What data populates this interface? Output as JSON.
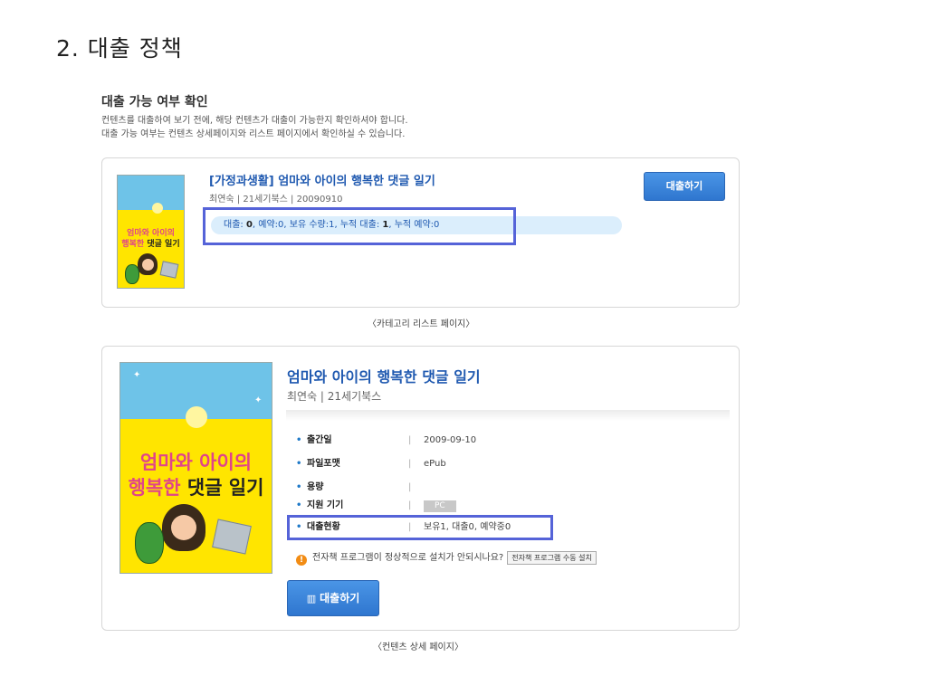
{
  "slide": {
    "title": "2. 대출 정책"
  },
  "section": {
    "title": "대출 가능 여부 확인",
    "desc_line1": "컨텐츠를 대출하여 보기 전에, 해당 컨텐츠가 대출이 가능한지 확인하셔야 합니다.",
    "desc_line2": "대출 가능 여부는 컨텐츠 상세페이지와 리스트 페이지에서 확인하실 수 있습니다."
  },
  "list_card": {
    "category": "[가정과생활]",
    "title": " 엄마와 아이의 행복한 댓글 일기",
    "meta": "최연숙 | 21세기북스 | 20090910",
    "stats_prefix": "대출: ",
    "stats_loan": "0",
    "stats_mid": ", 예약:0, 보유 수량:1, 누적 대출: ",
    "stats_total": "1",
    "stats_suffix": ", 누적 예약:0",
    "borrow_button": "대출하기",
    "caption": "〈카테고리 리스트 페이지〉"
  },
  "cover": {
    "heading_line1": "엄마와 아이의",
    "heading_line2a": "행복한 ",
    "heading_line2b": "댓글 일기"
  },
  "detail_card": {
    "title": "엄마와 아이의 행복한 댓글 일기",
    "meta": "최연숙 | 21세기북스",
    "rows": [
      {
        "label": "출간일",
        "value": "2009-09-10"
      },
      {
        "label": "파일포맷",
        "value": "ePub"
      },
      {
        "label": "용량",
        "value": ""
      },
      {
        "label": "지원 기기",
        "value": "PC"
      },
      {
        "label": "대출현황",
        "value": "보유1, 대출0, 예약중0"
      }
    ],
    "notice_text": "전자책 프로그램이 정상적으로 설치가 안되시나요?",
    "install_button": "전자책 프로그램 수동 설치",
    "borrow_button": "대출하기",
    "caption": "〈컨텐츠 상세 페이지〉"
  },
  "colors": {
    "accent": "#2f76cf",
    "highlight": "#5563d8",
    "link": "#1f59b0"
  },
  "icons": {
    "warning": "warning-icon",
    "book": "book-icon"
  }
}
